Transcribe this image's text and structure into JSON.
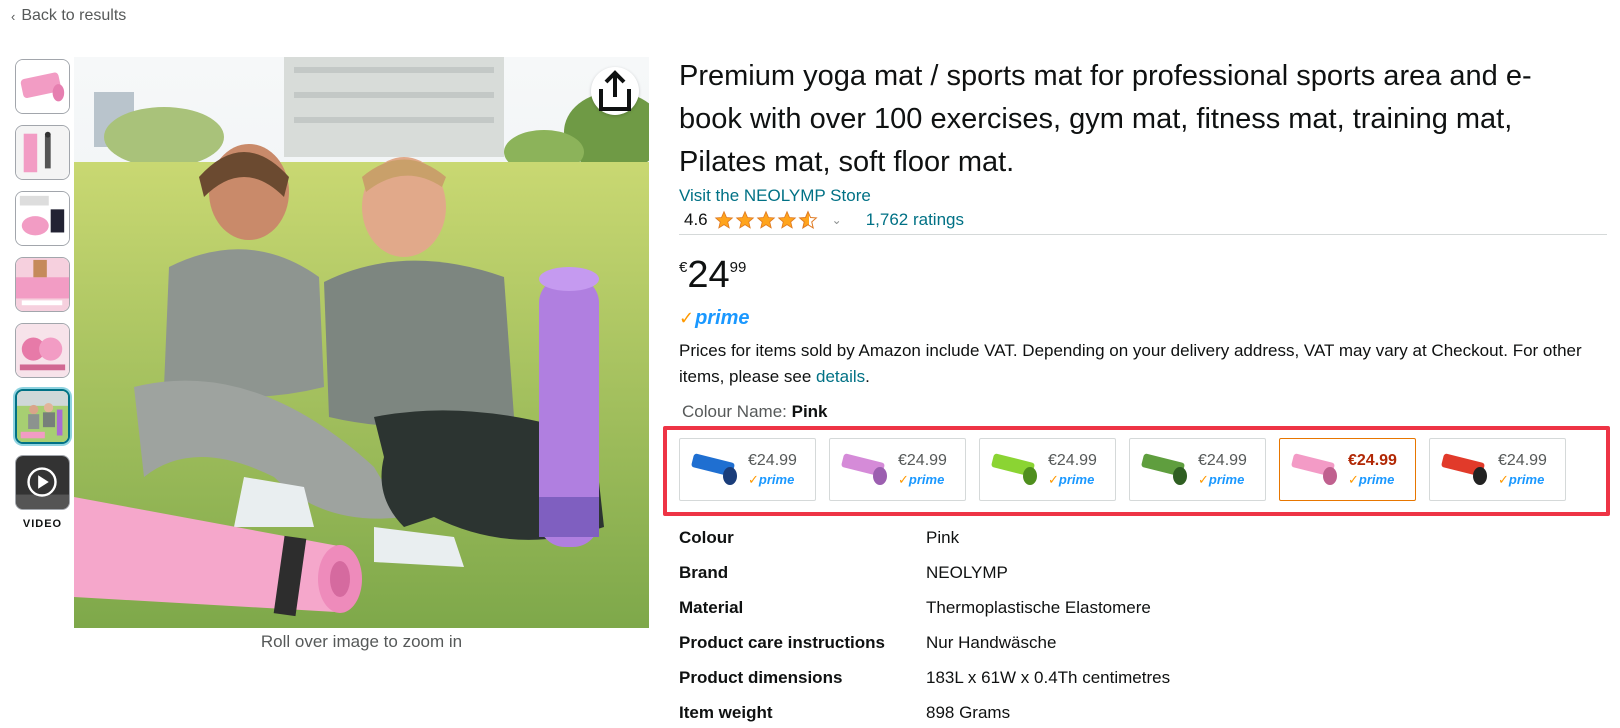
{
  "nav": {
    "back_label": "Back to results"
  },
  "thumbnails": {
    "video_label": "VIDEO"
  },
  "gallery": {
    "zoom_hint": "Roll over image to zoom in"
  },
  "product": {
    "title": "Premium yoga mat / sports mat for professional sports area and e-book with over 100 exercises, gym mat, fitness mat, training mat, Pilates mat, soft floor mat.",
    "store_link": "Visit the NEOLYMP Store",
    "rating": "4.6",
    "rating_stars": 4.6,
    "ratings_count": "1,762 ratings",
    "price_currency": "€",
    "price_whole": "24",
    "price_fraction": "99",
    "prime_label": "prime",
    "vat_text_prefix": "Prices for items sold by Amazon include VAT. Depending on your delivery address, VAT may vary at Checkout. For other items, please see ",
    "vat_link": "details",
    "vat_text_suffix": ".",
    "colour_label": "Colour Name: ",
    "colour_value": "Pink"
  },
  "swatches": [
    {
      "price": "€24.99",
      "prime": "prime",
      "color_top": "#1f6fd1",
      "color_bottom": "#1a3d7a"
    },
    {
      "price": "€24.99",
      "prime": "prime",
      "color_top": "#d58bd8",
      "color_bottom": "#9c5fb0"
    },
    {
      "price": "€24.99",
      "prime": "prime",
      "color_top": "#8bd433",
      "color_bottom": "#4f8f1e"
    },
    {
      "price": "€24.99",
      "prime": "prime",
      "color_top": "#5f9e3e",
      "color_bottom": "#2f5f22"
    },
    {
      "price": "€24.99",
      "prime": "prime",
      "color_top": "#f39bc6",
      "color_bottom": "#c0618f",
      "selected": true
    },
    {
      "price": "€24.99",
      "prime": "prime",
      "color_top": "#e13a2a",
      "color_bottom": "#222222"
    }
  ],
  "specs": [
    {
      "key": "Colour",
      "value": "Pink"
    },
    {
      "key": "Brand",
      "value": "NEOLYMP"
    },
    {
      "key": "Material",
      "value": "Thermoplastische Elastomere"
    },
    {
      "key": "Product care instructions",
      "value": "Nur Handwäsche"
    },
    {
      "key": "Product dimensions",
      "value": "183L x 61W x 0.4Th centimetres"
    },
    {
      "key": "Item weight",
      "value": "898 Grams"
    }
  ],
  "colors": {
    "link": "#007185",
    "prime_blue": "#1a98ff",
    "prime_check": "#ff9900",
    "highlight_box": "#ee3445",
    "selected_price": "#b12704",
    "star": "#ffa41c"
  }
}
